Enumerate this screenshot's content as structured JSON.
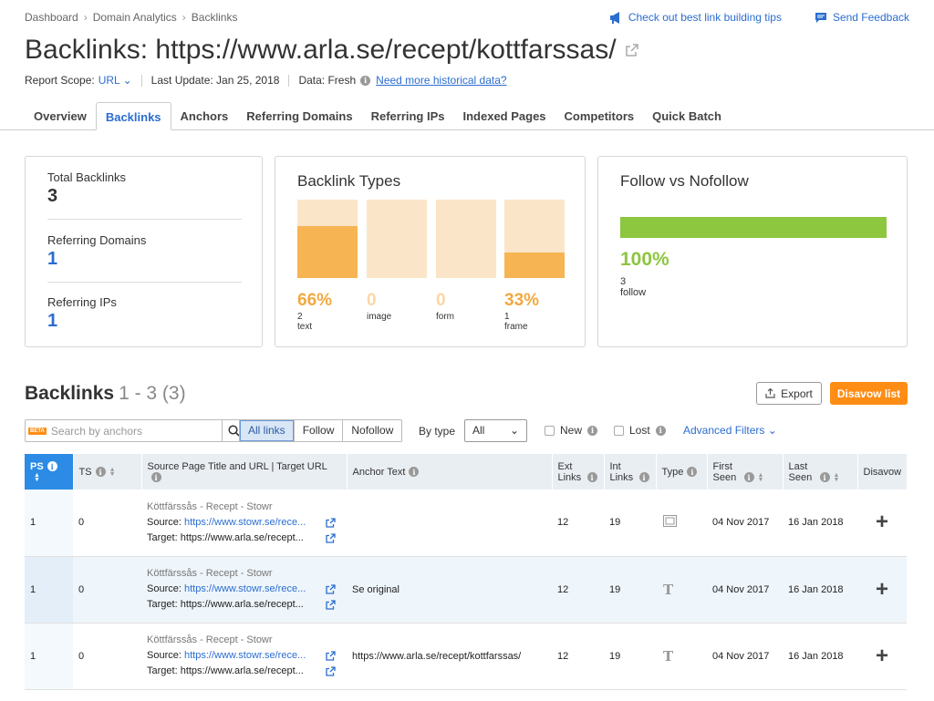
{
  "breadcrumb": [
    "Dashboard",
    "Domain Analytics",
    "Backlinks"
  ],
  "top_links": {
    "tips": "Check out best link building tips",
    "feedback": "Send Feedback"
  },
  "title": "Backlinks: https://www.arla.se/recept/kottfarssas/",
  "meta": {
    "scope_label": "Report Scope:",
    "scope_value": "URL",
    "last_update": "Last Update: Jan 25, 2018",
    "data_label": "Data: Fresh",
    "history_link": "Need more historical data?"
  },
  "tabs": [
    "Overview",
    "Backlinks",
    "Anchors",
    "Referring Domains",
    "Referring IPs",
    "Indexed Pages",
    "Competitors",
    "Quick Batch"
  ],
  "active_tab": "Backlinks",
  "summary": {
    "total_backlinks_label": "Total Backlinks",
    "total_backlinks": "3",
    "referring_domains_label": "Referring Domains",
    "referring_domains": "1",
    "referring_ips_label": "Referring IPs",
    "referring_ips": "1"
  },
  "backlink_types": {
    "title": "Backlink Types",
    "items": [
      {
        "pct": "66%",
        "count": "2",
        "label": "text",
        "fraction": 0.66
      },
      {
        "pct": "0",
        "count": "",
        "label": "image",
        "fraction": 0
      },
      {
        "pct": "0",
        "count": "",
        "label": "form",
        "fraction": 0
      },
      {
        "pct": "33%",
        "count": "1",
        "label": "frame",
        "fraction": 0.33
      }
    ]
  },
  "follow": {
    "title": "Follow vs Nofollow",
    "pct": "100%",
    "count": "3",
    "label": "follow",
    "fraction": 1.0
  },
  "section": {
    "title": "Backlinks",
    "range": "1 - 3 (3)",
    "export": "Export",
    "disavow_list": "Disavow list"
  },
  "filters": {
    "search_placeholder": "Search by anchors",
    "beta": "BETA",
    "link_types": [
      "All links",
      "Follow",
      "Nofollow"
    ],
    "by_type_label": "By type",
    "type_value": "All",
    "new_label": "New",
    "lost_label": "Lost",
    "advanced": "Advanced Filters"
  },
  "table": {
    "headers": {
      "ps": "PS",
      "ts": "TS",
      "source": "Source Page Title and URL | Target URL",
      "anchor": "Anchor Text",
      "ext": "Ext Links",
      "int": "Int Links",
      "type": "Type",
      "first": "First Seen",
      "last": "Last Seen",
      "disavow": "Disavow"
    },
    "rows": [
      {
        "ps": "1",
        "ts": "0",
        "title": "Köttfärssås - Recept - Stowr",
        "source_label": "Source:",
        "source": "https://www.stowr.se/rece...",
        "target_label": "Target:",
        "target": "https://www.arla.se/recept...",
        "anchor": "",
        "ext": "12",
        "int": "19",
        "type": "frame",
        "first": "04 Nov 2017",
        "last": "16 Jan 2018"
      },
      {
        "ps": "1",
        "ts": "0",
        "title": "Köttfärssås - Recept - Stowr",
        "source_label": "Source:",
        "source": "https://www.stowr.se/rece...",
        "target_label": "Target:",
        "target": "https://www.arla.se/recept...",
        "anchor": "Se original",
        "ext": "12",
        "int": "19",
        "type": "text",
        "first": "04 Nov 2017",
        "last": "16 Jan 2018"
      },
      {
        "ps": "1",
        "ts": "0",
        "title": "Köttfärssås - Recept - Stowr",
        "source_label": "Source:",
        "source": "https://www.stowr.se/rece...",
        "target_label": "Target:",
        "target": "https://www.arla.se/recept...",
        "anchor": "https://www.arla.se/recept/kottfarssas/",
        "ext": "12",
        "int": "19",
        "type": "text",
        "first": "04 Nov 2017",
        "last": "16 Jan 2018"
      }
    ]
  },
  "colors": {
    "accent": "#2b6dd0",
    "orange": "#ff8c14",
    "follow_green": "#8dc63f",
    "type_bar": "#f7b453",
    "type_bg": "#fbe5c8"
  }
}
